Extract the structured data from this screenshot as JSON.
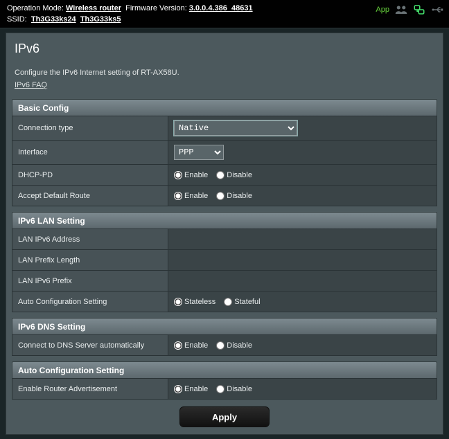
{
  "header": {
    "operation_mode_label": "Operation Mode:",
    "operation_mode_value": "Wireless router",
    "firmware_label": "Firmware Version:",
    "firmware_value": "3.0.0.4.386_48631",
    "ssid_label": "SSID:",
    "ssid1": "Th3G33ks24",
    "ssid2": "Th3G33ks5",
    "app_label": "App"
  },
  "page": {
    "title": "IPv6",
    "description": "Configure the IPv6 Internet setting of RT-AX58U.",
    "faq": "IPv6 FAQ"
  },
  "basic": {
    "section": "Basic Config",
    "connection_type_label": "Connection type",
    "connection_type_value": "Native",
    "interface_label": "Interface",
    "interface_value": "PPP",
    "dhcp_pd_label": "DHCP-PD",
    "accept_default_label": "Accept Default Route"
  },
  "lan": {
    "section": "IPv6 LAN Setting",
    "address_label": "LAN IPv6 Address",
    "prefix_len_label": "LAN Prefix Length",
    "prefix_label": "LAN IPv6 Prefix",
    "autocfg_label": "Auto Configuration Setting"
  },
  "dns": {
    "section": "IPv6 DNS Setting",
    "auto_label": "Connect to DNS Server automatically"
  },
  "autocfg": {
    "section": "Auto Configuration Setting",
    "ra_label": "Enable Router Advertisement"
  },
  "radio": {
    "enable": "Enable",
    "disable": "Disable",
    "stateless": "Stateless",
    "stateful": "Stateful"
  },
  "actions": {
    "apply": "Apply"
  }
}
